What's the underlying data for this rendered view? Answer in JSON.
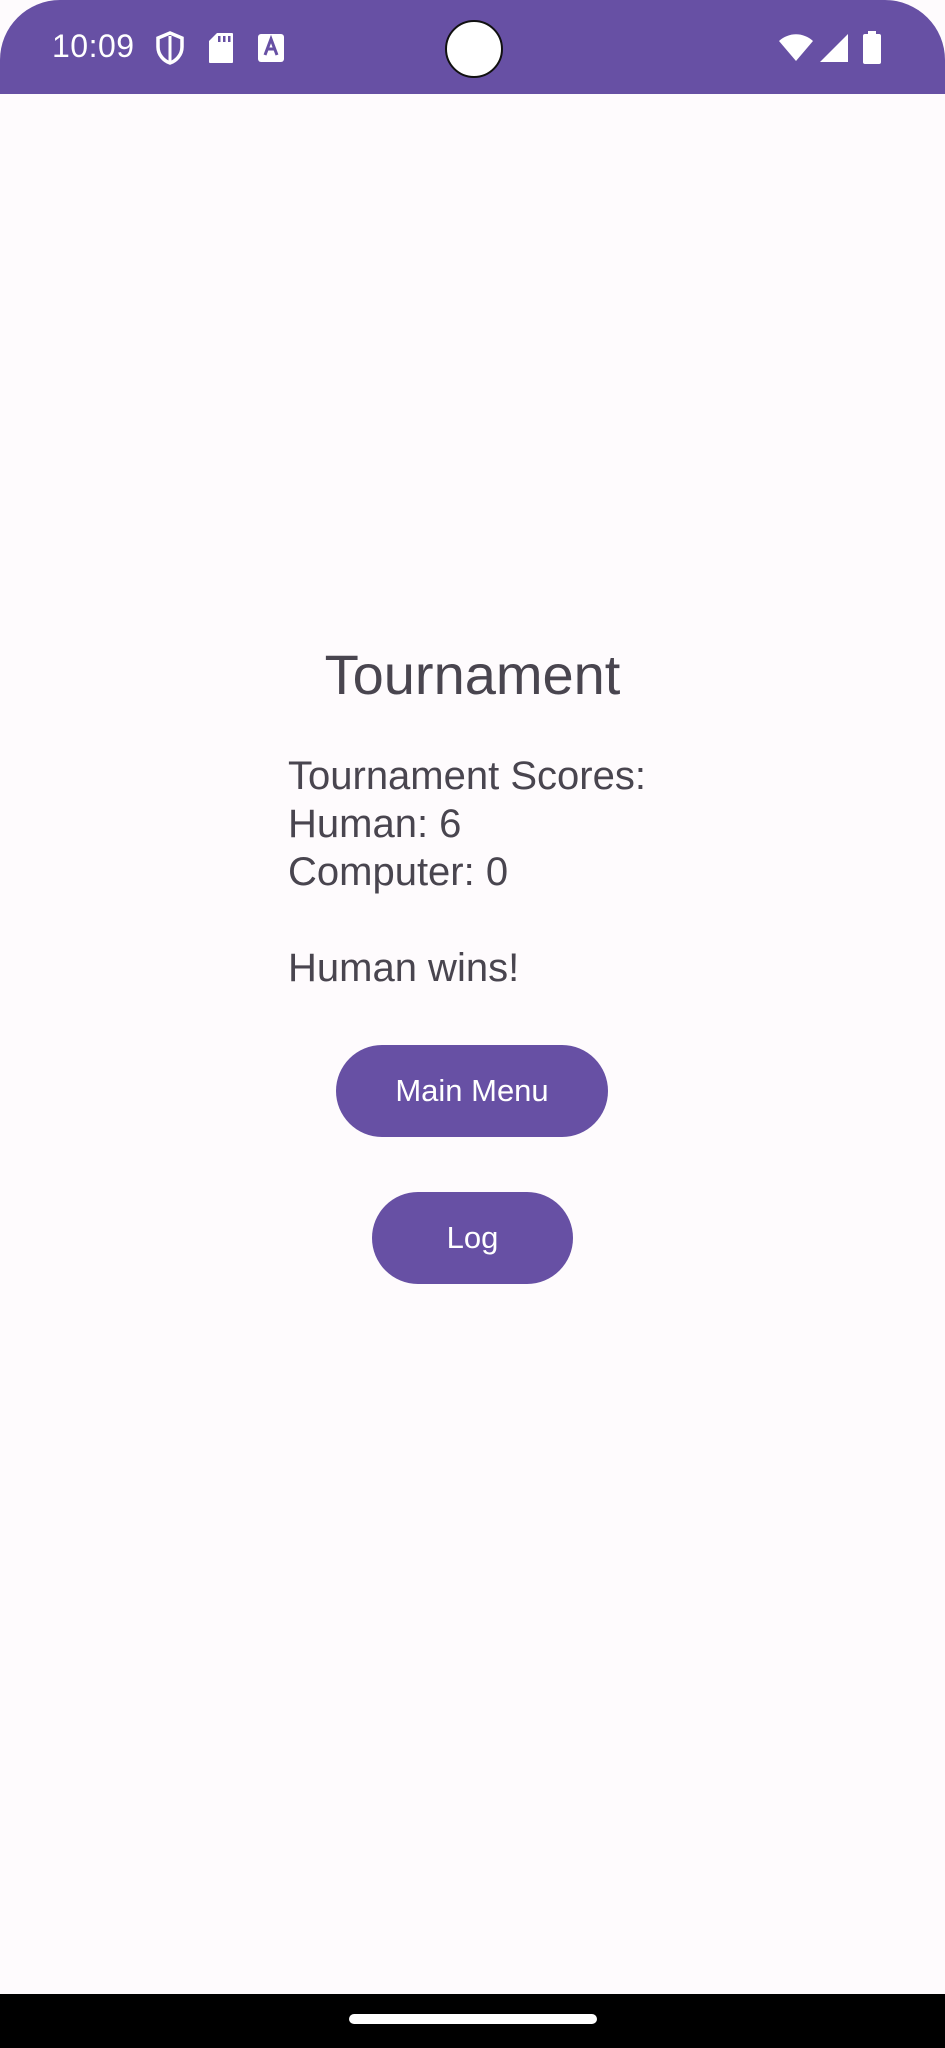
{
  "status_bar": {
    "time": "10:09",
    "color": "#6750a4",
    "left_icons": [
      "shield-icon",
      "sd-card-icon",
      "keyboard-a-icon"
    ],
    "right_icons": [
      "wifi-icon",
      "cell-signal-icon",
      "battery-icon"
    ]
  },
  "screen": {
    "title": "Tournament",
    "scores_heading": "Tournament Scores:",
    "human_score": "Human: 6",
    "computer_score": "Computer: 0",
    "result": "Human wins!"
  },
  "buttons": {
    "main_menu": "Main Menu",
    "log": "Log"
  },
  "colors": {
    "accent": "#6750a4",
    "background": "#fefbfd",
    "text": "#49454f"
  }
}
